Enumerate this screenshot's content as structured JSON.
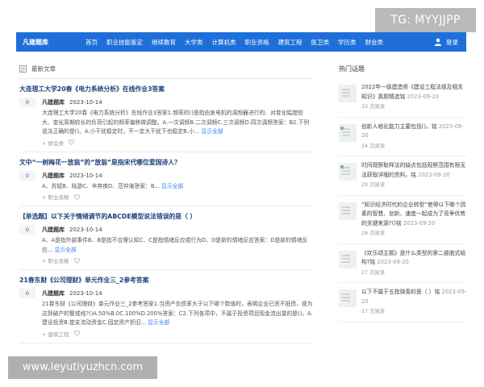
{
  "watermarks": {
    "top": "TG: MYYJJPP",
    "bottom": "www.leyutiyuzhcn.com"
  },
  "navbar": {
    "brand": "凡建题库",
    "items": [
      "首页",
      "职业技能鉴定",
      "继续教育",
      "大学类",
      "计算机类",
      "职业资格",
      "建筑工程",
      "医卫类",
      "学历类",
      "财会类"
    ],
    "login": "登录",
    "bg_color": "#1e6fd9"
  },
  "main": {
    "section_title": "最新文章",
    "articles": [
      {
        "title": "大连理工大学20春《电力系统分析》在线作业3答案",
        "votes": "0",
        "author": "凡建题库",
        "date": "2023-10-14",
        "text": "大连理工大学20春《电力系统分析》在线作业3答案1.频率的()是指由发电机的调频器进行的、对变化幅度较大、变化周期较长的负荷引起的频率偏移做调整。A.一次调频B.二次调频C.三次调频D.四次调频答案：B2.下列说法正确的是()。A.小干扰稳定时，不一定大干扰下也稳定B.小...",
        "more": "显示全部",
        "tag": "财会类"
      },
      {
        "title": "文中“一树梅花一放翁”的“放翁”是指宋代哪位爱国诗人？",
        "votes": "0",
        "author": "凡建题库",
        "date": "2023-10-14",
        "text": "A、苏轼B、陆游C、辛弃疾D、范仲淹答案：B...",
        "more": "显示全部",
        "tag": "职业资格"
      },
      {
        "title": "【单选题】以下关于情绪调节的ABCDE模型说法错误的是（ ）",
        "votes": "0",
        "author": "凡建题库",
        "date": "2023-10-14",
        "text": "A、A是指外部事件B、B是指不合理认知C、C是指情绪反应或行为D、D是新的情绪反应答案：D是新的情绪反应...",
        "more": "显示全部",
        "tag": "职业资格"
      },
      {
        "title": "21春东财《公司理财》单元作业三_2参考答案",
        "votes": "0",
        "author": "凡建题库",
        "date": "2023-10-14",
        "text": "21春东财《公司理财》单元作业三_2参考答案1.当资产负债率大于以下哪个数值时，表明企业已资不抵债，视为达到破产的警戒线?()A.50%B.0C.100%D.200%答案：C2.下列各项中，不属于投资项目现金流出量的是()。A.建设投资B.垫支流动资金C.固定资产折旧...",
        "more": "显示全部",
        "tag": "建筑工程"
      }
    ]
  },
  "sidebar": {
    "title": "热门话题",
    "items": [
      {
        "title": "2022年一级建造师《建设工程法规及相关知识》真题精选铭",
        "date": "2023-09-20",
        "views": "33 次阅读"
      },
      {
        "title": "创新人格化能力主要包括()。铭",
        "date": "2023-09-20",
        "views": "24 次阅读"
      },
      {
        "title": "时间观察取样法的缺点包括观察范围有限无法获取详细的资料。铭",
        "date": "2023-09-20",
        "views": "29 次阅读"
      },
      {
        "title": "“知识经济时代的企业转型”使得以下哪个因素的智慧、创新、速度一起成为了竞争优势的关键来源?()铭",
        "date": "2023-09-20",
        "views": "28 次阅读"
      },
      {
        "title": "《欢乐颂主题》是什么类型的第二部曲式结构?铭",
        "date": "2023-09-20",
        "views": "27 次阅读"
      },
      {
        "title": "以下不属于五指弹奏的是（ ）铭",
        "date": "2023-09-20",
        "views": "27 次阅读"
      }
    ]
  }
}
